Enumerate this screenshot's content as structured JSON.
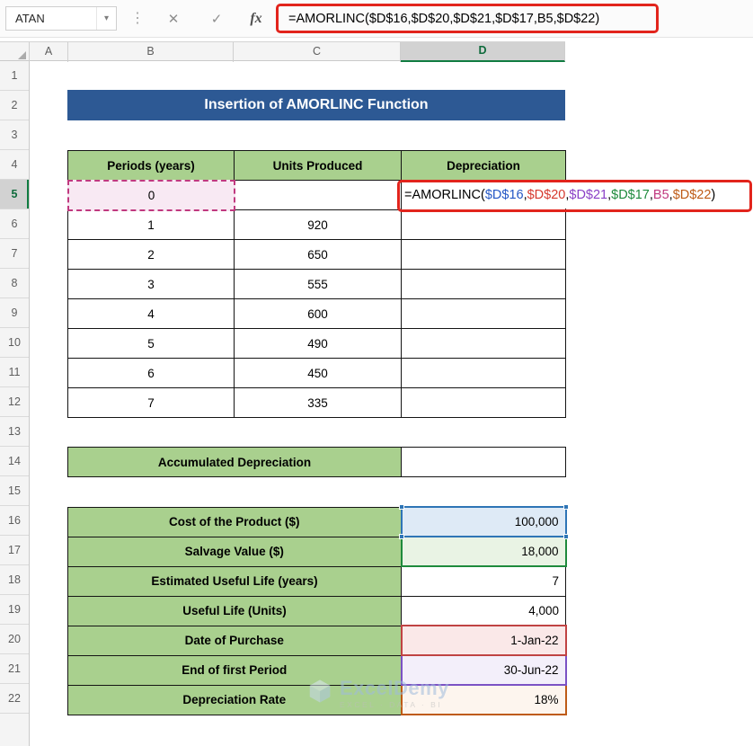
{
  "toolbar": {
    "name_box_value": "ATAN",
    "formula_bar_text": "=AMORLINC($D$16,$D$20,$D$21,$D$17,B5,$D$22)"
  },
  "icons": {
    "dropdown": "▾",
    "drag_handle": "⋮",
    "cancel": "✕",
    "enter": "✓",
    "insert_function": "fx"
  },
  "grid": {
    "column_headers": [
      "A",
      "B",
      "C",
      "D"
    ],
    "row_headers": [
      "1",
      "2",
      "3",
      "4",
      "5",
      "6",
      "7",
      "8",
      "9",
      "10",
      "11",
      "12",
      "13",
      "14",
      "15",
      "16",
      "17",
      "18",
      "19",
      "20",
      "21",
      "22"
    ]
  },
  "banner": {
    "text": "Insertion of AMORLINC Function",
    "bg": "#2D5994"
  },
  "depreciation_table": {
    "headers": {
      "periods": "Periods (years)",
      "units": "Units Produced",
      "depreciation": "Depreciation"
    },
    "rows": [
      {
        "period": "0",
        "units": ""
      },
      {
        "period": "1",
        "units": "920"
      },
      {
        "period": "2",
        "units": "650"
      },
      {
        "period": "3",
        "units": "555"
      },
      {
        "period": "4",
        "units": "600"
      },
      {
        "period": "5",
        "units": "490"
      },
      {
        "period": "6",
        "units": "450"
      },
      {
        "period": "7",
        "units": "335"
      }
    ]
  },
  "cell_formula": {
    "parts": [
      {
        "text": "=AMORLINC(",
        "color": "#000000"
      },
      {
        "text": "$D$16",
        "color": "#2457C5"
      },
      {
        "text": ",",
        "color": "#000000"
      },
      {
        "text": "$D$20",
        "color": "#D6392E"
      },
      {
        "text": ",",
        "color": "#000000"
      },
      {
        "text": "$D$21",
        "color": "#8A3FC6"
      },
      {
        "text": ",",
        "color": "#000000"
      },
      {
        "text": "$D$17",
        "color": "#1E8A3C"
      },
      {
        "text": ",",
        "color": "#000000"
      },
      {
        "text": "B5",
        "color": "#C0397F"
      },
      {
        "text": ",",
        "color": "#000000"
      },
      {
        "text": "$D$22",
        "color": "#BE5B16"
      },
      {
        "text": ")",
        "color": "#000000"
      }
    ]
  },
  "accumulated_row": {
    "label": "Accumulated Depreciation",
    "value": ""
  },
  "parameters": {
    "rows": [
      {
        "label": "Cost of the Product ($)",
        "value": "100,000"
      },
      {
        "label": "Salvage Value ($)",
        "value": "18,000"
      },
      {
        "label": "Estimated Useful Life (years)",
        "value": "7"
      },
      {
        "label": "Useful Life (Units)",
        "value": "4,000"
      },
      {
        "label": "Date of Purchase",
        "value": "1-Jan-22"
      },
      {
        "label": "End of first Period",
        "value": "30-Jun-22"
      },
      {
        "label": "Depreciation Rate",
        "value": "18%"
      }
    ]
  },
  "cell_highlights": {
    "b5": {
      "border": "#C0397F",
      "fill": "#F8E9F3"
    },
    "d16": {
      "border": "#2E75B6",
      "fill": "#DEEAF6"
    },
    "d17": {
      "border": "#1E8A3C",
      "fill": "#E9F3E4"
    },
    "d20": {
      "border": "#C04343",
      "fill": "#FAE8E8"
    },
    "d21": {
      "border": "#7B52C4",
      "fill": "#F3EFFA"
    },
    "d22": {
      "border": "#BE5B16",
      "fill": "#FDF5EE"
    }
  },
  "annotation": {
    "color": "#E2241C"
  },
  "watermark": {
    "name": "ExcelDemy",
    "tagline": "EXCEL · DATA · BI"
  }
}
